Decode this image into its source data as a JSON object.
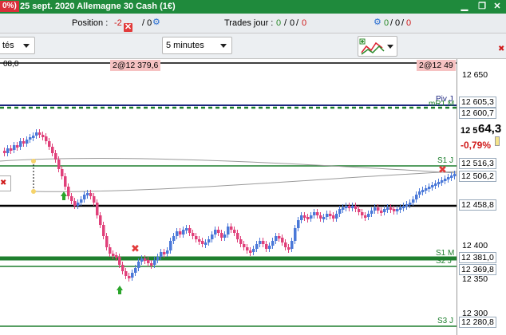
{
  "titlebar": {
    "change_pct": "0%)",
    "title": "25 sept. 2020 Allemagne 30 Cash (1€)"
  },
  "infobar": {
    "position_label": "Position :",
    "position_value": "-2",
    "position_sep": "/ 0",
    "trades_label": "Trades jour :",
    "trades_green": "0",
    "trades_sep1": "/",
    "trades_zero1": "0",
    "trades_sep2": "/",
    "trades_red": "0",
    "right_green": "0",
    "right_sep1": "/",
    "right_zero": "0",
    "right_sep2": "/",
    "right_red": "0"
  },
  "toolbar": {
    "left_dropdown": "tés",
    "interval_dropdown": "5 minutes"
  },
  "chart": {
    "top_left_label": "08,0",
    "order_label_1": "2@12 379,6",
    "order_label_2": "2@12 49",
    "axis_labels": [
      "12 650",
      "12 600,7",
      "12 5",
      "64,3",
      "-0,79%",
      "12 516,3",
      "12 506,2",
      "12 458,8",
      "12 400",
      "12 381,0",
      "12 369,8",
      "12 350",
      "12 300",
      "12 280,8"
    ],
    "axis_boxed": [
      "12 605,3",
      "12 600,7",
      "12 516,3",
      "12 506,2",
      "12 458,8",
      "12 381,0",
      "12 369,8",
      "12 280,8"
    ],
    "line_labels": {
      "piv": "Piv J",
      "mhr": "mR1 M",
      "s1j": "S1 J",
      "s1m": "S1 M",
      "s2j": "S2 J",
      "s3j": "S3 J"
    },
    "colors": {
      "up": "#4a78d8",
      "down": "#e0407a",
      "green_line": "#1e7f2e",
      "black_line": "#000000",
      "pivot_navy": "#1a237e"
    }
  }
}
